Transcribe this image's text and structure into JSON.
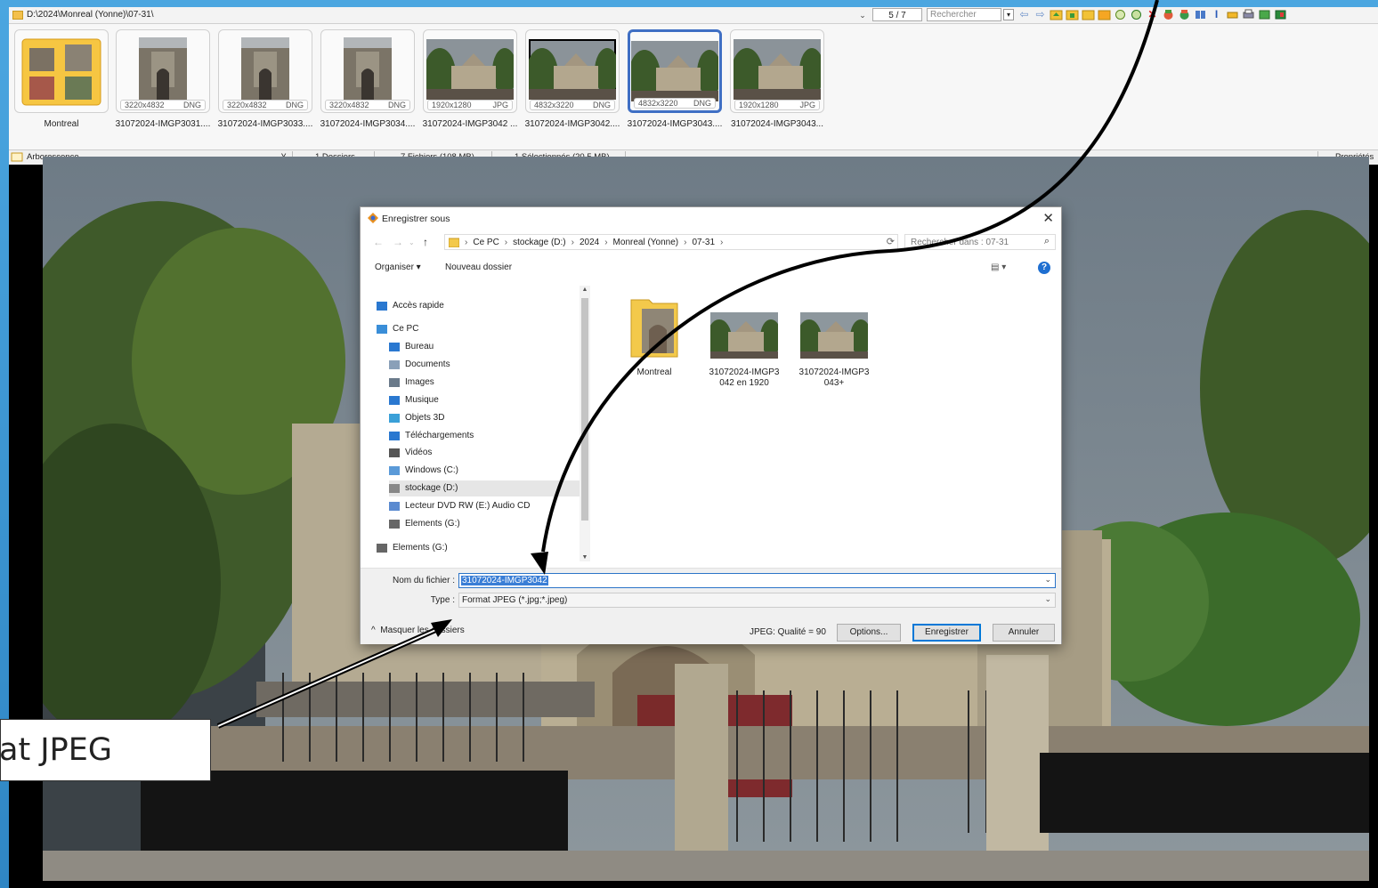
{
  "topbar": {
    "path": "D:\\2024\\Monreal (Yonne)\\07-31\\",
    "counter": "5 / 7",
    "search_placeholder": "Rechercher",
    "toolbar_icons": [
      "prev-arrow-icon",
      "next-arrow-icon",
      "folder-up-icon",
      "folder-copy-icon",
      "folder-move-icon",
      "folder-new-icon",
      "rotate-icon",
      "refresh-icon",
      "delete-icon",
      "tool-icon",
      "tool2-icon",
      "grid-icon",
      "text-icon",
      "printer-scan-icon",
      "print-icon",
      "image-icon",
      "exit-icon"
    ]
  },
  "thumbnails": [
    {
      "caption": "Montreal",
      "kind": "folder",
      "dims": "",
      "format": ""
    },
    {
      "caption": "31072024-IMGP3031....",
      "kind": "portrait",
      "dims": "3220x4832",
      "format": "DNG"
    },
    {
      "caption": "31072024-IMGP3033....",
      "kind": "portrait",
      "dims": "3220x4832",
      "format": "DNG"
    },
    {
      "caption": "31072024-IMGP3034....",
      "kind": "portrait",
      "dims": "3220x4832",
      "format": "DNG"
    },
    {
      "caption": "31072024-IMGP3042 ...",
      "kind": "landscape",
      "dims": "1920x1280",
      "format": "JPG"
    },
    {
      "caption": "31072024-IMGP3042....",
      "kind": "landscape",
      "dims": "4832x3220",
      "format": "DNG"
    },
    {
      "caption": "31072024-IMGP3043....",
      "kind": "landscape",
      "dims": "4832x3220",
      "format": "DNG",
      "selected": true
    },
    {
      "caption": "31072024-IMGP3043...",
      "kind": "landscape",
      "dims": "1920x1280",
      "format": "JPG"
    }
  ],
  "statusbar": {
    "tree": "Arborescence",
    "folders": "1 Dossiers",
    "files": "7 Fichiers (108 MB)",
    "selected": "1 Sélectionnés (20.5 MB)",
    "properties": "Propriétés d"
  },
  "dialog": {
    "title": "Enregistrer sous",
    "breadcrumbs": [
      "Ce PC",
      "stockage (D:)",
      "2024",
      "Monreal (Yonne)",
      "07-31"
    ],
    "search_placeholder": "Rechercher dans : 07-31",
    "organiser": "Organiser ▾",
    "new_folder": "Nouveau dossier",
    "nav_items": [
      {
        "label": "Accès rapide",
        "icon": "star-icon",
        "indent": 0
      },
      {
        "label": "Ce PC",
        "icon": "computer-icon",
        "indent": 0
      },
      {
        "label": "Bureau",
        "icon": "desktop-icon",
        "indent": 1
      },
      {
        "label": "Documents",
        "icon": "documents-icon",
        "indent": 1
      },
      {
        "label": "Images",
        "icon": "images-icon",
        "indent": 1
      },
      {
        "label": "Musique",
        "icon": "music-icon",
        "indent": 1
      },
      {
        "label": "Objets 3D",
        "icon": "cube-icon",
        "indent": 1
      },
      {
        "label": "Téléchargements",
        "icon": "download-icon",
        "indent": 1
      },
      {
        "label": "Vidéos",
        "icon": "video-icon",
        "indent": 1
      },
      {
        "label": "Windows (C:)",
        "icon": "drive-c-icon",
        "indent": 1
      },
      {
        "label": "stockage (D:)",
        "icon": "drive-d-icon",
        "indent": 1,
        "selected": true
      },
      {
        "label": "Lecteur DVD RW (E:) Audio CD",
        "icon": "dvd-icon",
        "indent": 1
      },
      {
        "label": "Elements (G:)",
        "icon": "drive-g-icon",
        "indent": 1
      },
      {
        "label": "Elements (G:)",
        "icon": "drive-g-icon",
        "indent": 0
      }
    ],
    "files": [
      {
        "label1": "Montreal",
        "label2": "",
        "kind": "folder"
      },
      {
        "label1": "31072024-IMGP3",
        "label2": "042 en 1920",
        "kind": "image"
      },
      {
        "label1": "31072024-IMGP3",
        "label2": "043+",
        "kind": "image"
      }
    ],
    "filename_label": "Nom du fichier :",
    "filename_value": "31072024-IMGP3042",
    "type_label": "Type :",
    "type_value": "Format JPEG (*.jpg;*.jpeg)",
    "hide_folders": "Masquer les dossiers",
    "quality": "JPEG: Qualité = 90",
    "options": "Options...",
    "save": "Enregistrer",
    "cancel": "Annuler"
  },
  "callout": {
    "text": "at JPEG"
  }
}
